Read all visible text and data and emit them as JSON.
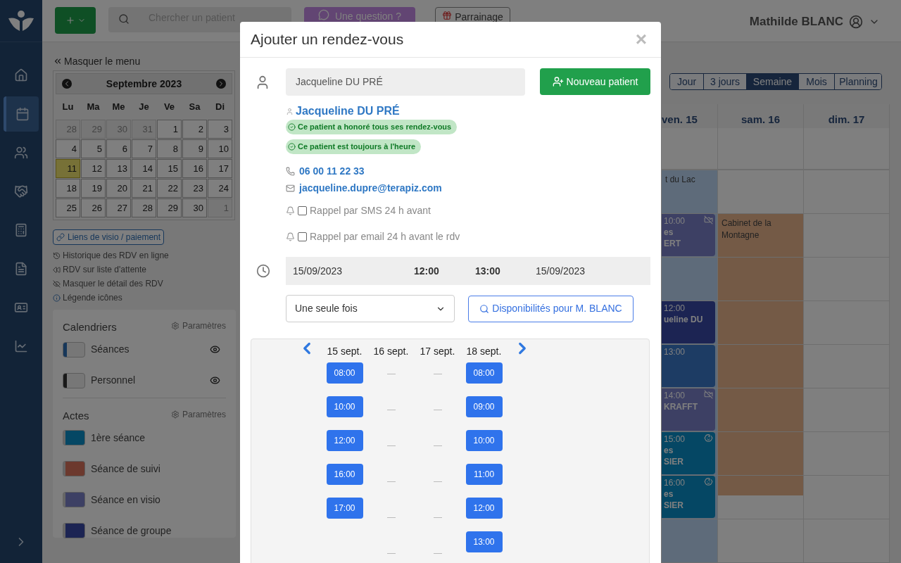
{
  "topbar": {
    "search": {
      "placeholder": "Chercher un patient"
    },
    "question": "Une question ?",
    "referral": "Parrainage",
    "user": "Mathilde BLANC"
  },
  "nav": [
    {
      "selected": false
    },
    {
      "selected": true
    },
    {
      "selected": false
    },
    {
      "selected": false
    },
    {
      "selected": false
    },
    {
      "selected": false
    },
    {
      "selected": false
    },
    {
      "selected": false
    }
  ],
  "sidebar": {
    "hide_menu": "Masquer le menu",
    "mini_calendar": {
      "month": "Septembre 2023",
      "weekdays": [
        "Lu",
        "Ma",
        "Me",
        "Je",
        "Ve",
        "Sa",
        "Di"
      ],
      "days": [
        {
          "label": "28",
          "muted": true,
          "today": false
        },
        {
          "label": "29",
          "muted": true,
          "today": false
        },
        {
          "label": "30",
          "muted": true,
          "today": false
        },
        {
          "label": "31",
          "muted": true,
          "today": false
        },
        {
          "label": "1",
          "muted": false,
          "today": false
        },
        {
          "label": "2",
          "muted": false,
          "today": false
        },
        {
          "label": "3",
          "muted": false,
          "today": false
        },
        {
          "label": "4",
          "muted": false,
          "today": false
        },
        {
          "label": "5",
          "muted": false,
          "today": false
        },
        {
          "label": "6",
          "muted": false,
          "today": false
        },
        {
          "label": "7",
          "muted": false,
          "today": false
        },
        {
          "label": "8",
          "muted": false,
          "today": false
        },
        {
          "label": "9",
          "muted": false,
          "today": false
        },
        {
          "label": "10",
          "muted": false,
          "today": false
        },
        {
          "label": "11",
          "muted": false,
          "today": true
        },
        {
          "label": "12",
          "muted": false,
          "today": false
        },
        {
          "label": "13",
          "muted": false,
          "today": false
        },
        {
          "label": "14",
          "muted": false,
          "today": false
        },
        {
          "label": "15",
          "muted": false,
          "today": false
        },
        {
          "label": "16",
          "muted": false,
          "today": false
        },
        {
          "label": "17",
          "muted": false,
          "today": false
        },
        {
          "label": "18",
          "muted": false,
          "today": false
        },
        {
          "label": "19",
          "muted": false,
          "today": false
        },
        {
          "label": "20",
          "muted": false,
          "today": false
        },
        {
          "label": "21",
          "muted": false,
          "today": false
        },
        {
          "label": "22",
          "muted": false,
          "today": false
        },
        {
          "label": "23",
          "muted": false,
          "today": false
        },
        {
          "label": "24",
          "muted": false,
          "today": false
        },
        {
          "label": "25",
          "muted": false,
          "today": false
        },
        {
          "label": "26",
          "muted": false,
          "today": false
        },
        {
          "label": "27",
          "muted": false,
          "today": false
        },
        {
          "label": "28",
          "muted": false,
          "today": false
        },
        {
          "label": "29",
          "muted": false,
          "today": false
        },
        {
          "label": "30",
          "muted": false,
          "today": false
        },
        {
          "label": "1",
          "muted": true,
          "today": false
        }
      ]
    },
    "links": [
      {
        "kind": "button",
        "label": "Liens de visio / paiement"
      },
      {
        "kind": "history",
        "label": "Historique des RDV en ligne"
      },
      {
        "kind": "waitlist",
        "label": "RDV sur liste d'attente"
      },
      {
        "kind": "hide",
        "label": "Masquer le détail des RDV"
      },
      {
        "kind": "info",
        "label": "Légende icônes"
      }
    ],
    "calendars": {
      "title": "Calendriers",
      "settings": "Paramètres",
      "items": [
        {
          "label": "Séances",
          "color": "#17375a",
          "visible": true
        },
        {
          "label": "Personnel",
          "color": "#191919",
          "visible": true
        }
      ]
    },
    "acts": {
      "title": "Actes",
      "settings": "Paramètres",
      "items": [
        {
          "label": "1ère séance",
          "color": "#054764"
        },
        {
          "label": "Séance de suivi",
          "color": "#6c392e"
        },
        {
          "label": "Séance en visio",
          "color": "#3d4064"
        },
        {
          "label": "Séance de groupe",
          "color": "#1c2453"
        }
      ]
    }
  },
  "calendar": {
    "views": [
      {
        "label": "Jour",
        "selected": false
      },
      {
        "label": "3 jours",
        "selected": false
      },
      {
        "label": "Semaine",
        "selected": true
      },
      {
        "label": "Mois",
        "selected": false
      },
      {
        "label": "Planning",
        "selected": false
      }
    ],
    "days": [
      {
        "label": "ven. 15",
        "rows": [
          {
            "kind": "place",
            "color": "#5e6b7a",
            "lines": [
              "t du Lac"
            ]
          },
          {
            "kind": "visio",
            "color": "#3d4064",
            "lines": [
              "10:00",
              "es",
              "ERT"
            ]
          },
          {
            "kind": "place",
            "color": "#5e6b7a",
            "lines": []
          },
          {
            "kind": "plain",
            "color": "#1c2453",
            "lines": [
              "12:00",
              "ueline DU"
            ]
          },
          {
            "kind": "plain",
            "color": "#1d3c64",
            "lines": [
              "13:00"
            ]
          },
          {
            "kind": "visio",
            "color": "#3d4064",
            "lines": [
              "14:00",
              "KRAFFT"
            ]
          },
          {
            "kind": "child",
            "color": "#054764",
            "lines": [
              "15:00",
              "es",
              "SIER"
            ]
          },
          {
            "kind": "child",
            "color": "#054764",
            "lines": [
              "16:00",
              "es",
              "SIER"
            ]
          },
          {
            "kind": "place",
            "color": "#5e6b7a",
            "lines": []
          }
        ]
      },
      {
        "label": "sam. 16",
        "rows": [
          {
            "kind": "empty"
          },
          {
            "kind": "place",
            "color": "#745a46",
            "lines": [
              "Cabinet de la Montagne"
            ]
          },
          {
            "kind": "place",
            "color": "#745a46",
            "lines": []
          },
          {
            "kind": "place",
            "color": "#745a46",
            "lines": []
          },
          {
            "kind": "place",
            "color": "#745a46",
            "lines": []
          },
          {
            "kind": "place",
            "color": "#745a46",
            "lines": []
          },
          {
            "kind": "place",
            "color": "#745a46",
            "lines": []
          },
          {
            "kind": "place-end",
            "color": "#745a46",
            "lines": []
          },
          {
            "kind": "empty"
          }
        ]
      },
      {
        "label": "dim. 17",
        "rows": [
          {
            "kind": "empty"
          },
          {
            "kind": "empty"
          },
          {
            "kind": "empty"
          },
          {
            "kind": "empty"
          },
          {
            "kind": "empty"
          },
          {
            "kind": "empty"
          },
          {
            "kind": "empty"
          },
          {
            "kind": "empty"
          },
          {
            "kind": "empty"
          }
        ]
      }
    ]
  },
  "modal": {
    "title": "Ajouter un rendez-vous",
    "close": "×",
    "patient_field": {
      "value": "Jacqueline DU PRÉ"
    },
    "new_patient": "Nouveau patient",
    "patient": {
      "name": "Jacqueline DU PRÉ",
      "badges": [
        "Ce patient a honoré tous ses rendez-vous",
        "Ce patient est toujours à l'heure"
      ],
      "phone": "06 00 11 22 33",
      "email": "jacqueline.dupre@terapiz.com"
    },
    "reminders": [
      {
        "label": "Rappel par SMS 24 h avant",
        "checked": false
      },
      {
        "label": "Rappel par email 24 h avant le rdv",
        "checked": false
      }
    ],
    "when": {
      "start_date": "15/09/2023",
      "start_time": "12:00",
      "end_time": "13:00",
      "end_date": "15/09/2023"
    },
    "repeat": {
      "value": "Une seule fois"
    },
    "availability_button": "Disponibilités pour M. BLANC",
    "availability": [
      {
        "label": "15 sept.",
        "slots": [
          {
            "kind": "time",
            "text": "08:00"
          },
          {
            "kind": "time",
            "text": "10:00"
          },
          {
            "kind": "time",
            "text": "12:00"
          },
          {
            "kind": "time",
            "text": "16:00"
          },
          {
            "kind": "time",
            "text": "17:00"
          }
        ]
      },
      {
        "label": "16 sept.",
        "slots": [
          {
            "kind": "none"
          },
          {
            "kind": "none"
          },
          {
            "kind": "none"
          },
          {
            "kind": "none"
          },
          {
            "kind": "none"
          },
          {
            "kind": "none"
          }
        ]
      },
      {
        "label": "17 sept.",
        "slots": [
          {
            "kind": "none"
          },
          {
            "kind": "none"
          },
          {
            "kind": "none"
          },
          {
            "kind": "none"
          },
          {
            "kind": "none"
          },
          {
            "kind": "none"
          }
        ]
      },
      {
        "label": "18 sept.",
        "slots": [
          {
            "kind": "time",
            "text": "08:00"
          },
          {
            "kind": "time",
            "text": "09:00"
          },
          {
            "kind": "time",
            "text": "10:00"
          },
          {
            "kind": "time",
            "text": "11:00"
          },
          {
            "kind": "time",
            "text": "12:00"
          },
          {
            "kind": "time",
            "text": "13:00"
          }
        ]
      }
    ]
  }
}
